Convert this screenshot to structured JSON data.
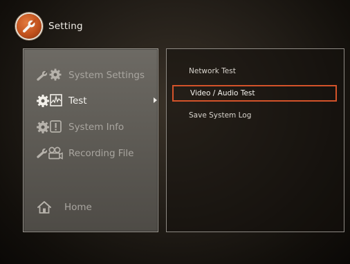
{
  "header": {
    "title": "Setting",
    "icon": "wrench-icon",
    "accent_color": "#c2521d"
  },
  "sidebar": {
    "items": [
      {
        "label": "System Settings",
        "icon": "wrench-gear-icon",
        "active": false
      },
      {
        "label": "Test",
        "icon": "gear-chart-icon",
        "active": true,
        "has_submenu": true
      },
      {
        "label": "System Info",
        "icon": "gear-info-icon",
        "active": false
      },
      {
        "label": "Recording File",
        "icon": "wrench-camera-icon",
        "active": false
      },
      {
        "label": "Home",
        "icon": "home-icon",
        "active": false
      }
    ]
  },
  "submenu": {
    "items": [
      {
        "label": "Network Test",
        "selected": false
      },
      {
        "label": "Video / Audio Test",
        "selected": true
      },
      {
        "label": "Save System Log",
        "selected": false
      }
    ],
    "selection_color": "#d4532a"
  }
}
